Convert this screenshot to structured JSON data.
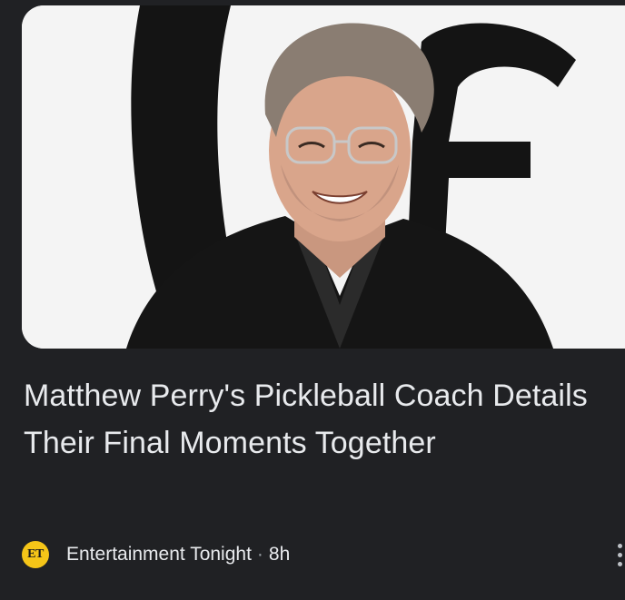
{
  "article": {
    "headline": "Matthew Perry's Pickleball Coach Details Their Final Moments Together",
    "image_subject": "Smiling man with gray hair and glasses wearing a dark blazer"
  },
  "source": {
    "logo_text": "ET",
    "name": "Entertainment Tonight",
    "separator": "·",
    "age": "8h"
  },
  "icons": {
    "source_logo": "et-logo-icon",
    "menu": "more-vert-icon"
  },
  "colors": {
    "background": "#202124",
    "text": "#e8eaed",
    "logo": "#f5c518"
  }
}
